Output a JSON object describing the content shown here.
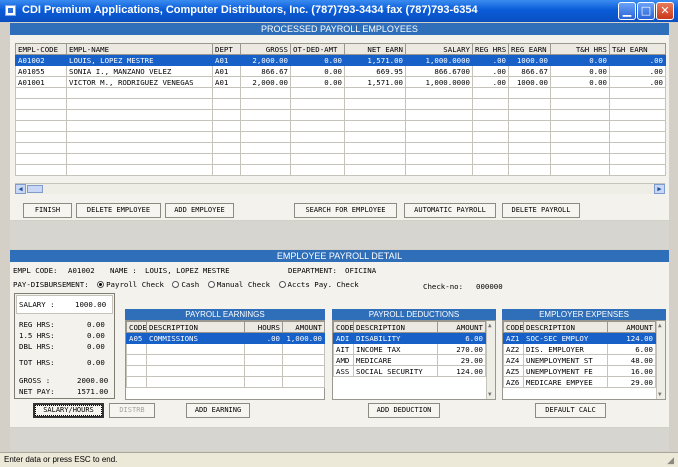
{
  "window": {
    "title": "CDI Premium Applications, Computer Distributors, Inc. (787)793-3434 fax (787)793-6354"
  },
  "processed": {
    "header": "PROCESSED PAYROLL EMPLOYEES",
    "columns": [
      "EMPL-CODE",
      "EMPL-NAME",
      "DEPT",
      "GROSS",
      "OT-DED-AMT",
      "NET EARN",
      "SALARY",
      "REG HRS",
      "REG EARN",
      "T&H HRS",
      "T&H EARN"
    ],
    "rows": [
      [
        "A01002",
        "LOUIS, LOPEZ MESTRE",
        "A01",
        "2,000.00",
        "0.00",
        "1,571.00",
        "1,000.0000",
        ".00",
        "1000.00",
        "0.00",
        ".00"
      ],
      [
        "A01055",
        "SONIA I., MANZANO VELEZ",
        "A01",
        "866.67",
        "0.00",
        "669.95",
        "866.6700",
        ".00",
        "866.67",
        "0.00",
        ".00"
      ],
      [
        "A01001",
        "VICTOR M., RODRIGUEZ VENEGAS",
        "A01",
        "2,000.00",
        "0.00",
        "1,571.00",
        "1,000.0000",
        ".00",
        "1000.00",
        "0.00",
        ".00"
      ]
    ],
    "buttons": {
      "finish": "FINISH",
      "delete_employee": "DELETE EMPLOYEE",
      "add_employee": "ADD EMPLOYEE",
      "search_employee": "SEARCH FOR EMPLOYEE",
      "automatic_payroll": "AUTOMATIC PAYROLL",
      "delete_payroll": "DELETE PAYROLL"
    }
  },
  "detail": {
    "header": "EMPLOYEE PAYROLL DETAIL",
    "empl_code_label": "EMPL CODE:",
    "empl_code": "A01002",
    "name_label": "NAME :",
    "name": "LOUIS, LOPEZ MESTRE",
    "department_label": "DEPARTMENT:",
    "department": "OFICINA",
    "disbursement_label": "PAY-DISBURSEMENT:",
    "disbursement_options": [
      "Payroll Check",
      "Cash",
      "Manual Check",
      "Accts Pay. Check"
    ],
    "disbursement_selected": "Payroll Check",
    "check_no_label": "Check-no:",
    "check_no": "000000",
    "summary": {
      "salary_label": "SALARY :",
      "salary": "1000.00",
      "reg_label": "REG HRS:",
      "reg": "0.00",
      "ot_label": "1.5 HRS:",
      "ot": "0.00",
      "dbl_label": "DBL HRS:",
      "dbl": "0.00",
      "tot_label": "TOT HRS:",
      "tot": "0.00",
      "gross_label": "GROSS  :",
      "gross": "2000.00",
      "net_label": "NET PAY:",
      "net": "1571.00"
    }
  },
  "earnings": {
    "header": "PAYROLL EARNINGS",
    "columns": [
      "CODE",
      "DESCRIPTION",
      "HOURS",
      "AMOUNT"
    ],
    "rows": [
      [
        "A05",
        "COMMISSIONS",
        ".00",
        "1,000.00"
      ]
    ]
  },
  "deductions": {
    "header": "PAYROLL DEDUCTIONS",
    "columns": [
      "CODE",
      "DESCRIPTION",
      "AMOUNT"
    ],
    "rows": [
      [
        "ADI",
        "DISABILITY",
        "6.00"
      ],
      [
        "AIT",
        "INCOME TAX",
        "270.00"
      ],
      [
        "AMD",
        "MEDICARE",
        "29.00"
      ],
      [
        "ASS",
        "SOCIAL SECURITY",
        "124.00"
      ]
    ]
  },
  "expenses": {
    "header": "EMPLOYER EXPENSES",
    "columns": [
      "CODE",
      "DESCRIPTION",
      "AMOUNT"
    ],
    "rows": [
      [
        "AZ1",
        "SOC-SEC EMPLOY",
        "124.00"
      ],
      [
        "AZ2",
        "DIS. EMPLOYER",
        "6.00"
      ],
      [
        "AZ4",
        "UNEMPLOYMENT ST",
        "48.00"
      ],
      [
        "AZ5",
        "UNEMPLOYMENT FE",
        "16.00"
      ],
      [
        "AZ6",
        "MEDICARE EMPYEE",
        "29.00"
      ]
    ]
  },
  "buttons": {
    "salary_hours": "SALARY/HOURS",
    "distrb": "DISTRB",
    "add_earning": "ADD EARNING",
    "add_deduction": "ADD DEDUCTION",
    "default_calc": "DEFAULT CALC"
  },
  "status": {
    "text": "Enter data or press ESC to end."
  }
}
